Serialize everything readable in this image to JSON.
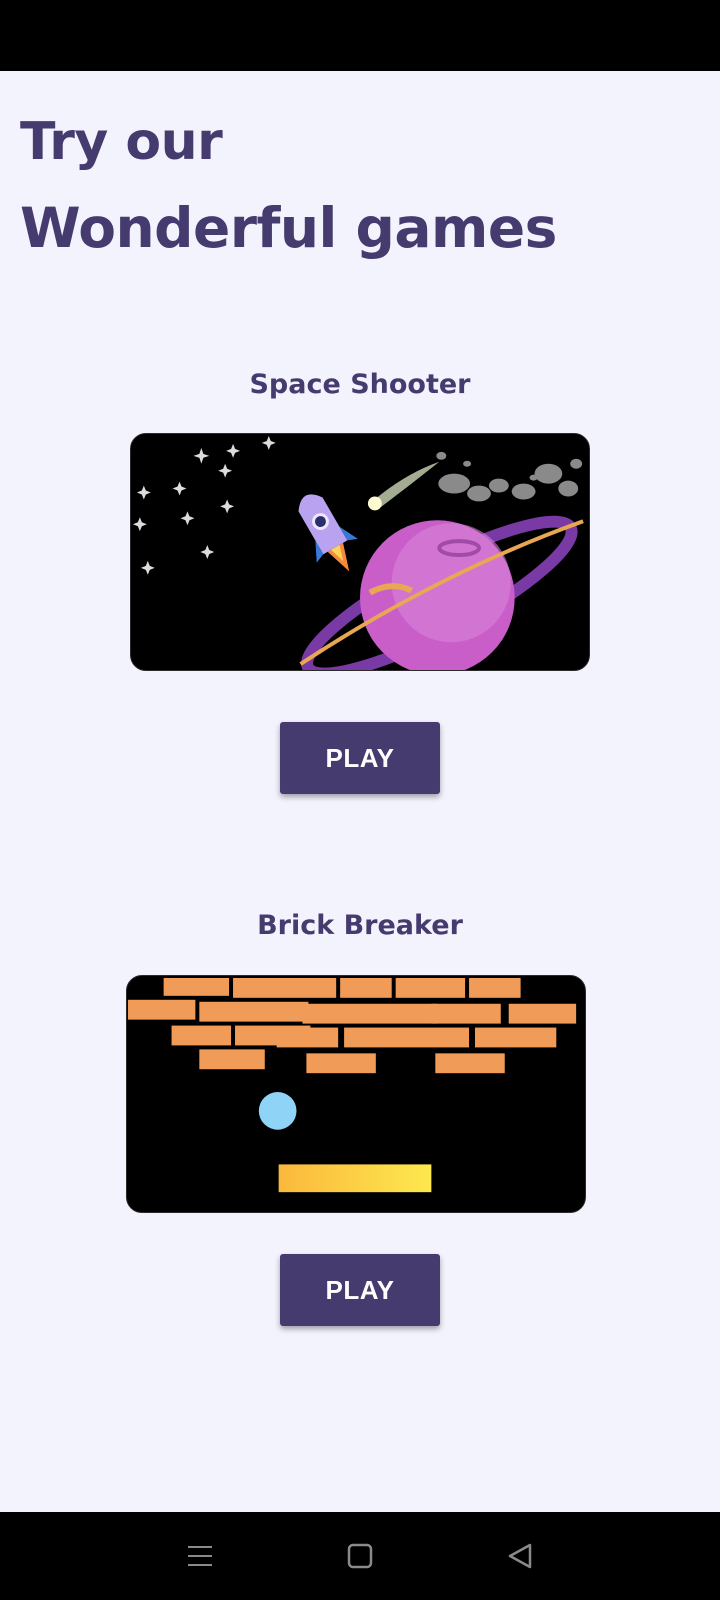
{
  "headline": {
    "line1": "Try our",
    "line2": "Wonderful games"
  },
  "games": [
    {
      "title": "Space Shooter",
      "play_label": "PLAY",
      "thumbnail": "space-shooter-thumbnail"
    },
    {
      "title": "Brick Breaker",
      "play_label": "PLAY",
      "thumbnail": "brick-breaker-thumbnail"
    }
  ],
  "colors": {
    "background": "#f3f3fd",
    "accent": "#463b6e",
    "brick": "#f09c58",
    "paddle": "#fbd748",
    "ball": "#8fd3f7"
  },
  "nav": {
    "icons": [
      "menu-icon",
      "home-square-icon",
      "back-triangle-icon"
    ]
  }
}
